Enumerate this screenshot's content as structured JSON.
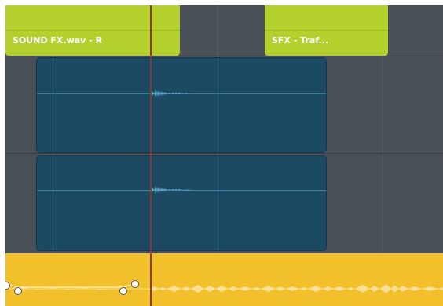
{
  "clips": {
    "top_left": {
      "label": "SOUND FX.wav - R"
    },
    "top_right": {
      "label": "SFX - Traf..."
    }
  },
  "colors": {
    "timeline_bg": "#4a5058",
    "green_clip": "#b4d12e",
    "blue_clip": "#1d4a63",
    "yellow_track": "#f2c02a",
    "playhead": "#8a3a2c"
  }
}
